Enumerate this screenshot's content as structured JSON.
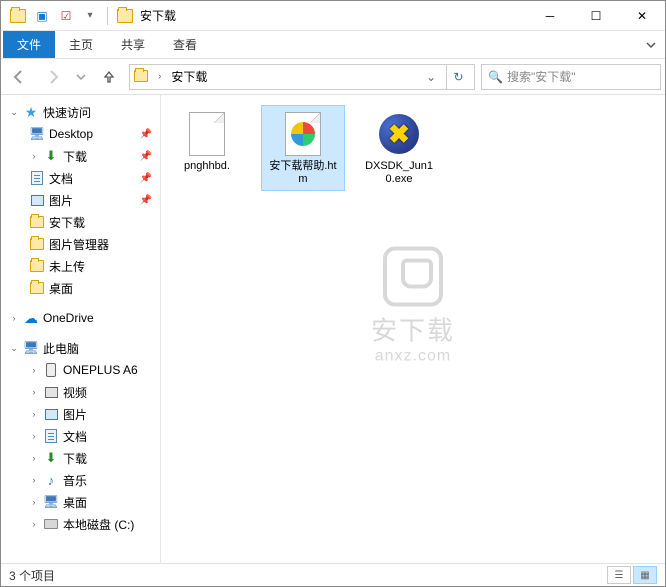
{
  "titlebar": {
    "title": "安下载"
  },
  "tabs": {
    "file": "文件",
    "home": "主页",
    "share": "共享",
    "view": "查看"
  },
  "address": {
    "segment": "安下载"
  },
  "search": {
    "placeholder": "搜索\"安下载\""
  },
  "sidebar": {
    "quick": "快速访问",
    "desktop": "Desktop",
    "downloads": "下载",
    "documents": "文档",
    "pictures": "图片",
    "anxz": "安下载",
    "picmgr": "图片管理器",
    "unupload": "未上传",
    "desk2": "桌面",
    "onedrive": "OneDrive",
    "thispc": "此电脑",
    "oneplus": "ONEPLUS A6",
    "video": "视频",
    "pics2": "图片",
    "docs2": "文档",
    "dl2": "下载",
    "music": "音乐",
    "desk3": "桌面",
    "localdisk": "本地磁盘 (C:)"
  },
  "files": {
    "f1": "pnghhbd.",
    "f2": "安下载帮助.htm",
    "f3": "DXSDK_Jun10.exe"
  },
  "watermark": {
    "big": "安下载",
    "small": "anxz.com"
  },
  "status": {
    "count": "3 个项目"
  }
}
